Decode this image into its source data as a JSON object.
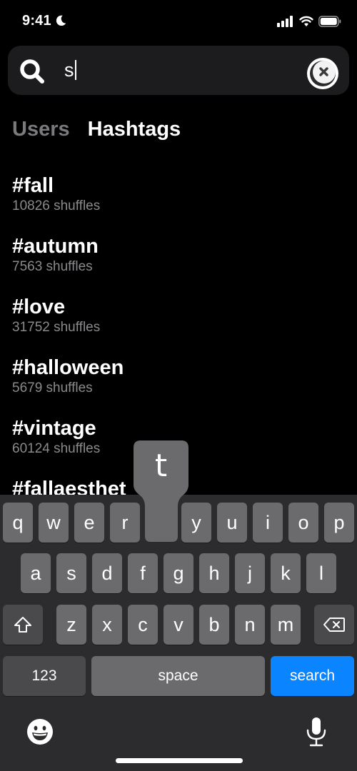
{
  "status_bar": {
    "time": "9:41",
    "icons": [
      "moon-icon",
      "signal-icon",
      "wifi-icon",
      "battery-icon"
    ]
  },
  "search": {
    "value": "s",
    "icon": "search-icon",
    "clear_icon": "clear-icon"
  },
  "tabs": [
    {
      "label": "Users",
      "active": false
    },
    {
      "label": "Hashtags",
      "active": true
    }
  ],
  "results": [
    {
      "tag": "#fall",
      "count": "10826 shuffles"
    },
    {
      "tag": "#autumn",
      "count": "7563 shuffles"
    },
    {
      "tag": "#love",
      "count": "31752 shuffles"
    },
    {
      "tag": "#halloween",
      "count": "5679 shuffles"
    },
    {
      "tag": "#vintage",
      "count": "60124 shuffles"
    },
    {
      "tag": "#fallaesthet",
      "count": ""
    }
  ],
  "keyboard": {
    "popup_key": "t",
    "row1": [
      "q",
      "w",
      "e",
      "r",
      "t",
      "y",
      "u",
      "i",
      "o",
      "p"
    ],
    "row2": [
      "a",
      "s",
      "d",
      "f",
      "g",
      "h",
      "j",
      "k",
      "l"
    ],
    "row3": [
      "z",
      "x",
      "c",
      "v",
      "b",
      "n",
      "m"
    ],
    "numbers_label": "123",
    "space_label": "space",
    "search_label": "search",
    "accent_color": "#0a84ff"
  }
}
